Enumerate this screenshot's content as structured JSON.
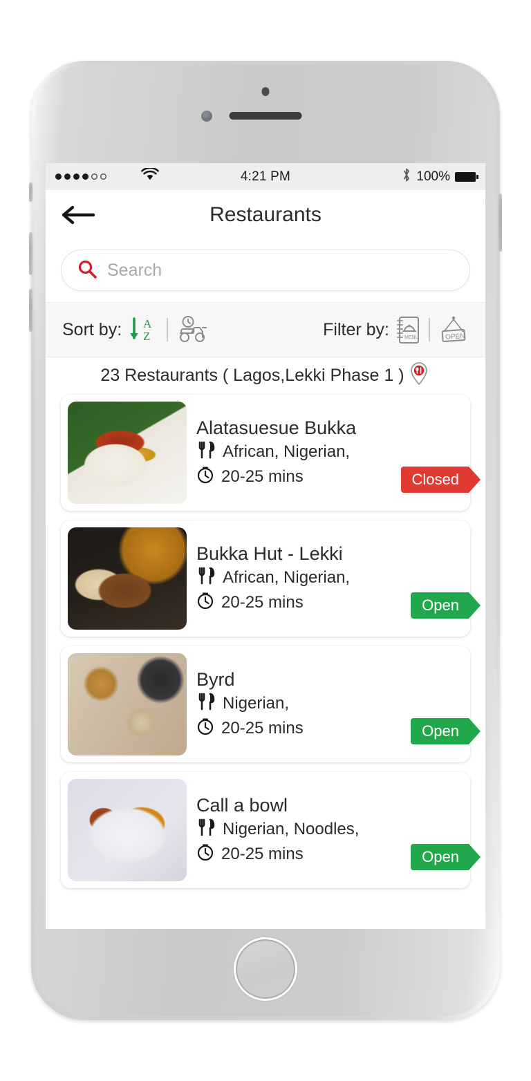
{
  "status_bar": {
    "signal_filled": 4,
    "signal_empty": 2,
    "wifi_icon": "wifi-icon",
    "time": "4:21 PM",
    "bluetooth_icon": "bluetooth-icon",
    "battery_percent": "100%",
    "battery_icon": "battery-full-icon"
  },
  "nav": {
    "back_icon": "back-arrow-icon",
    "menu_icon": "hamburger-menu-icon",
    "title": "Restaurants"
  },
  "search": {
    "icon": "search-icon",
    "placeholder": "Search",
    "value": ""
  },
  "sort_filter": {
    "sort_label": "Sort by:",
    "sort_options": [
      {
        "name": "sort-alphabetical",
        "icon": "sort-az-arrow-icon",
        "letters": [
          "A",
          "Z"
        ]
      },
      {
        "name": "sort-delivery-time",
        "icon": "scooter-clock-icon"
      }
    ],
    "filter_label": "Filter by:",
    "filter_options": [
      {
        "name": "filter-menu",
        "icon": "menu-book-icon",
        "caption": "MENU"
      },
      {
        "name": "filter-open",
        "icon": "open-sign-icon",
        "caption": "OPEN"
      }
    ]
  },
  "results": {
    "count": 23,
    "text": "23 Restaurants  ( Lagos,Lekki Phase 1 )",
    "city": "Lagos",
    "area": "Lekki Phase 1",
    "location_icon": "map-pin-restaurant-icon"
  },
  "icons": {
    "cuisine": "cutlery-icon",
    "time": "clock-icon"
  },
  "colors": {
    "open": "#22a84c",
    "closed": "#e03a33",
    "search_accent": "#cf2027",
    "sort_active": "#1f9e4a"
  },
  "restaurants": [
    {
      "name": "Alatasuesue Bukka",
      "cuisines": "African, Nigerian,",
      "delivery_time": "20-25 mins",
      "status": "Closed",
      "status_type": "closed",
      "thumb_class": "thumb-1",
      "thumb_alt": "jollof-rice-plate-photo"
    },
    {
      "name": "Bukka Hut - Lekki",
      "cuisines": "African, Nigerian,",
      "delivery_time": "20-25 mins",
      "status": "Open",
      "status_type": "open",
      "thumb_class": "thumb-2",
      "thumb_alt": "bukka-hut-rice-chicken-photo"
    },
    {
      "name": "Byrd",
      "cuisines": "Nigerian,",
      "delivery_time": "20-25 mins",
      "status": "Open",
      "status_type": "open",
      "thumb_class": "thumb-3",
      "thumb_alt": "byrd-platter-spread-photo"
    },
    {
      "name": "Call a bowl",
      "cuisines": "Nigerian, Noodles,",
      "delivery_time": "20-25 mins",
      "status": "Open",
      "status_type": "open",
      "thumb_class": "thumb-4",
      "thumb_alt": "jollof-rice-plantain-photo"
    }
  ]
}
